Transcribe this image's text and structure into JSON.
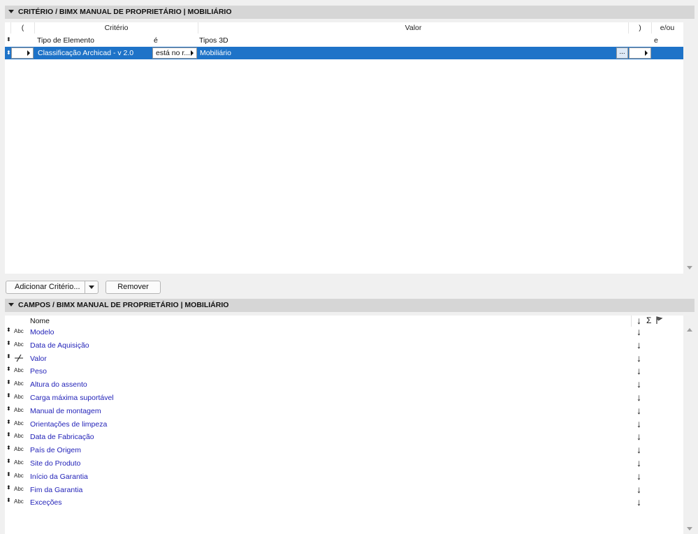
{
  "criteria_section": {
    "title": "CRITÉRIO / BIMX MANUAL DE PROPRIETÁRIO | MOBILIÁRIO",
    "columns": {
      "open_paren": "(",
      "criterio": "Critério",
      "valor": "Valor",
      "close_paren": ")",
      "and_or": "e/ou"
    },
    "subheaders": {
      "element_type": "Tipo de Elemento",
      "is": "é",
      "types_3d": "Tipos 3D",
      "and": "e"
    },
    "row": {
      "criterio": "Classificação Archicad - v 2.0",
      "operator": "está no r...",
      "valor": "Mobiliário",
      "more": "..."
    }
  },
  "buttons": {
    "add_criterion": "Adicionar Critério...",
    "remove": "Remover"
  },
  "fields_section": {
    "title": "CAMPOS / BIMX MANUAL DE PROPRIETÁRIO | MOBILIÁRIO",
    "name_header": "Nome",
    "header_icons": {
      "sort": "↓",
      "sum": "Σ",
      "flag": "flag-icon"
    },
    "type_label": "Abc",
    "fields": [
      {
        "type": "Abc",
        "name": "Modelo"
      },
      {
        "type": "Abc",
        "name": "Data de Aquisição"
      },
      {
        "type": "number-icon",
        "name": "Valor"
      },
      {
        "type": "Abc",
        "name": "Peso"
      },
      {
        "type": "Abc",
        "name": "Altura do assento"
      },
      {
        "type": "Abc",
        "name": "Carga máxima suportável"
      },
      {
        "type": "Abc",
        "name": "Manual de montagem"
      },
      {
        "type": "Abc",
        "name": "Orientações de limpeza"
      },
      {
        "type": "Abc",
        "name": "Data de Fabricação"
      },
      {
        "type": "Abc",
        "name": "País de Origem"
      },
      {
        "type": "Abc",
        "name": "Site do Produto"
      },
      {
        "type": "Abc",
        "name": "Início da Garantia"
      },
      {
        "type": "Abc",
        "name": "Fim da Garantia"
      },
      {
        "type": "Abc",
        "name": "Exceções"
      }
    ]
  },
  "colors": {
    "selection": "#1e73c8",
    "field_name": "#2323b8",
    "section_header": "#d6d6d6"
  }
}
